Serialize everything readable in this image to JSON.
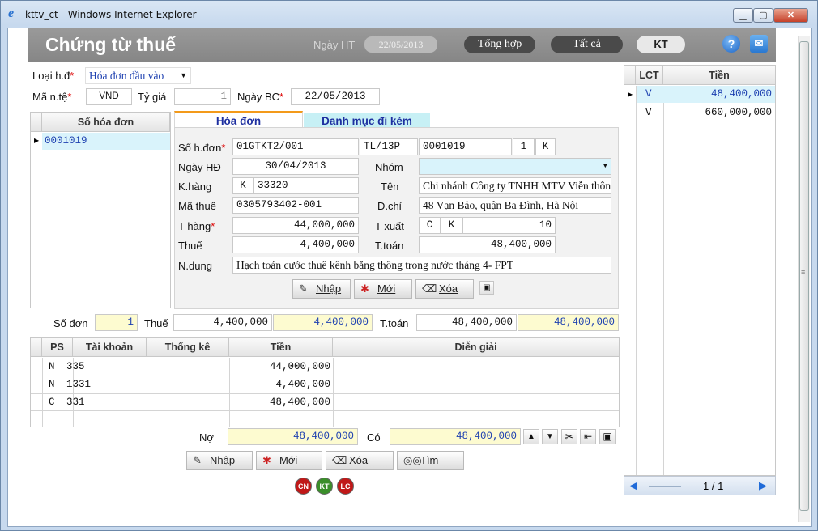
{
  "window": {
    "title": "kttv_ct - Windows Internet Explorer",
    "ie_glyph": "e"
  },
  "header": {
    "title": "Chứng từ thuế",
    "date_label": "Ngày HT",
    "date_value": "22/05/2013",
    "btn_summary": "Tổng hợp",
    "btn_all": "Tất cả",
    "btn_kt": "KT",
    "help_icon": "help-icon",
    "mail_icon": "mail-icon"
  },
  "form": {
    "invoice_type_label": "Loại h.đ",
    "invoice_type_value": "Hóa đơn đầu vào",
    "currency_label": "Mã n.tệ",
    "currency_value": "VND",
    "rate_label": "Tỷ giá",
    "rate_value": "1",
    "report_date_label": "Ngày BC",
    "report_date_value": "22/05/2013"
  },
  "invoice_list": {
    "header": "Số hóa đơn",
    "items": [
      "0001019"
    ]
  },
  "tabs": {
    "invoice": "Hóa đơn",
    "attachments": "Danh mục đi kèm"
  },
  "detail": {
    "no_label": "Số h.đơn",
    "form_code": "01GTKT2/001",
    "series": "TL/13P",
    "number": "0001019",
    "num1": "1",
    "code1": "K",
    "date_label": "Ngày HĐ",
    "date_value": "30/04/2013",
    "group_label": "Nhóm",
    "group_value": "",
    "customer_label": "K.hàng",
    "customer_prefix": "K",
    "customer_code": "33320",
    "name_label": "Tên",
    "name_value": "Chi nhánh Công ty TNHH MTV Viễn thôn",
    "tax_code_label": "Mã thuế",
    "tax_code_value": "0305793402-001",
    "address_label": "Đ.chỉ",
    "address_value": "48 Vạn Bảo, quận Ba Đình, Hà Nội",
    "goods_label": "T hàng",
    "goods_value": "44,000,000",
    "export_label": "T xuất",
    "export_c": "C",
    "export_k": "K",
    "export_value": "10",
    "tax_label": "Thuế",
    "tax_value": "4,400,000",
    "total_label": "T.toán",
    "total_value": "48,400,000",
    "content_label": "N.dung",
    "content_value": "Hạch toán cước thuê kênh băng thông trong nước tháng 4- FPT",
    "btn_enter": "Nhập",
    "btn_new": "Mới",
    "btn_delete": "Xóa"
  },
  "summary": {
    "count_label": "Số đơn",
    "count_value": "1",
    "tax_label": "Thuế",
    "tax_value": "4,400,000",
    "tax_value2": "4,400,000",
    "total_label": "T.toán",
    "total_value": "48,400,000",
    "total_value2": "48,400,000"
  },
  "entries": {
    "headers": [
      "PS",
      "Tài khoản",
      "Thống kê",
      "Tiền",
      "Diễn giải"
    ],
    "rows": [
      {
        "ps": "N",
        "account": "335",
        "stat": "",
        "amount": "44,000,000",
        "desc": ""
      },
      {
        "ps": "N",
        "account": "1331",
        "stat": "",
        "amount": "4,400,000",
        "desc": ""
      },
      {
        "ps": "C",
        "account": "331",
        "stat": "",
        "amount": "48,400,000",
        "desc": ""
      }
    ],
    "debit_label": "Nợ",
    "debit_value": "48,400,000",
    "credit_label": "Có",
    "credit_value": "48,400,000",
    "btn_enter": "Nhập",
    "btn_new": "Mới",
    "btn_delete": "Xóa",
    "btn_find": "Tìm",
    "circles": [
      "CN",
      "KT",
      "LC"
    ]
  },
  "right_list": {
    "headers": [
      "LCT",
      "Tiền"
    ],
    "rows": [
      {
        "lct": "V",
        "amount": "48,400,000"
      },
      {
        "lct": "V",
        "amount": "660,000,000"
      }
    ],
    "pager": "1 / 1"
  },
  "colors": {
    "header_bg": "#8f8f8f",
    "yellow_field": "#fdfbd0",
    "tab_active_top": "#f39a1a",
    "selected_row": "#d9f3fb"
  }
}
